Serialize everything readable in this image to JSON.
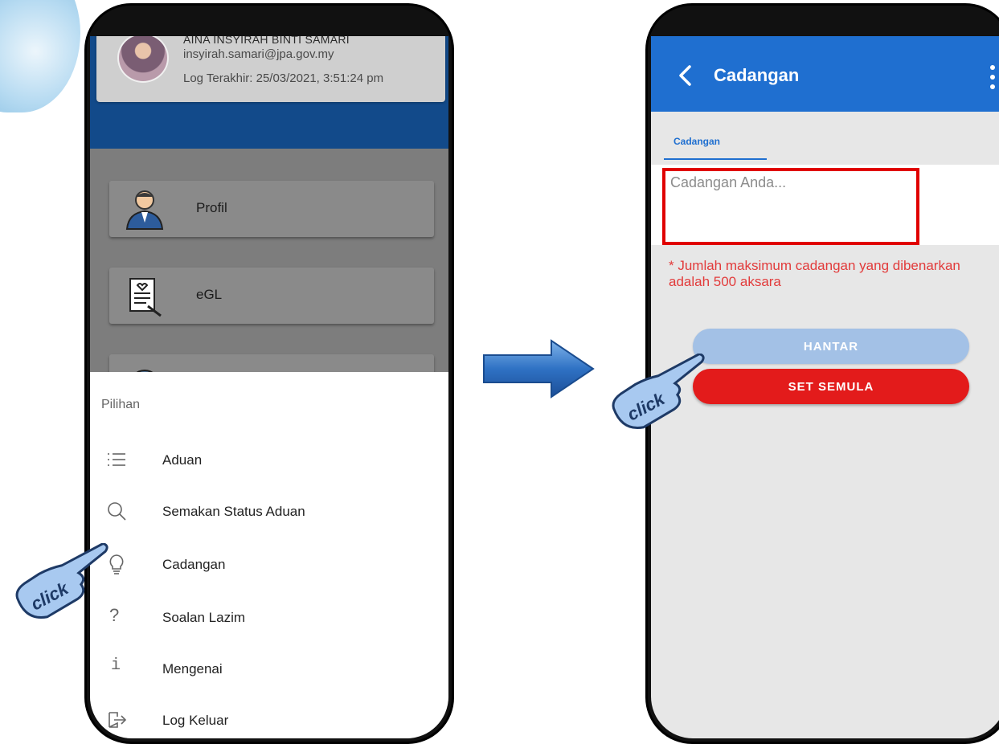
{
  "left_phone": {
    "profile": {
      "name": "AINA INSYIRAH BINTI SAMARI",
      "email": "insyirah.samari@jpa.gov.my",
      "last_login": "Log Terakhir: 25/03/2021, 3:51:24 pm"
    },
    "menu_buttons": [
      {
        "label": "Profil",
        "icon": "user-icon"
      },
      {
        "label": "eGL",
        "icon": "document-icon"
      }
    ],
    "sheet": {
      "title": "Pilihan",
      "items": [
        {
          "label": "Aduan",
          "icon": "list-icon"
        },
        {
          "label": "Semakan Status Aduan",
          "icon": "search-icon"
        },
        {
          "label": "Cadangan",
          "icon": "lightbulb-icon"
        },
        {
          "label": "Soalan Lazim",
          "icon": "question-icon"
        },
        {
          "label": "Mengenai",
          "icon": "info-icon"
        },
        {
          "label": "Log Keluar",
          "icon": "logout-icon"
        }
      ]
    }
  },
  "right_phone": {
    "app_bar_title": "Cadangan",
    "tab_label": "Cadangan",
    "input_placeholder": "Cadangan Anda...",
    "input_value": "",
    "note": "* Jumlah maksimum cadangan yang dibenarkan adalah 500 aksara",
    "submit_label": "HANTAR",
    "reset_label": "SET SEMULA"
  },
  "annotations": {
    "hand_label": "click"
  },
  "colors": {
    "app_bar": "#1f6fd0",
    "left_header": "#124a8a",
    "reset_button": "#e31b1b",
    "submit_button": "#a3c1e6",
    "highlight_box": "#e00000",
    "note_text": "#e23b3b"
  }
}
